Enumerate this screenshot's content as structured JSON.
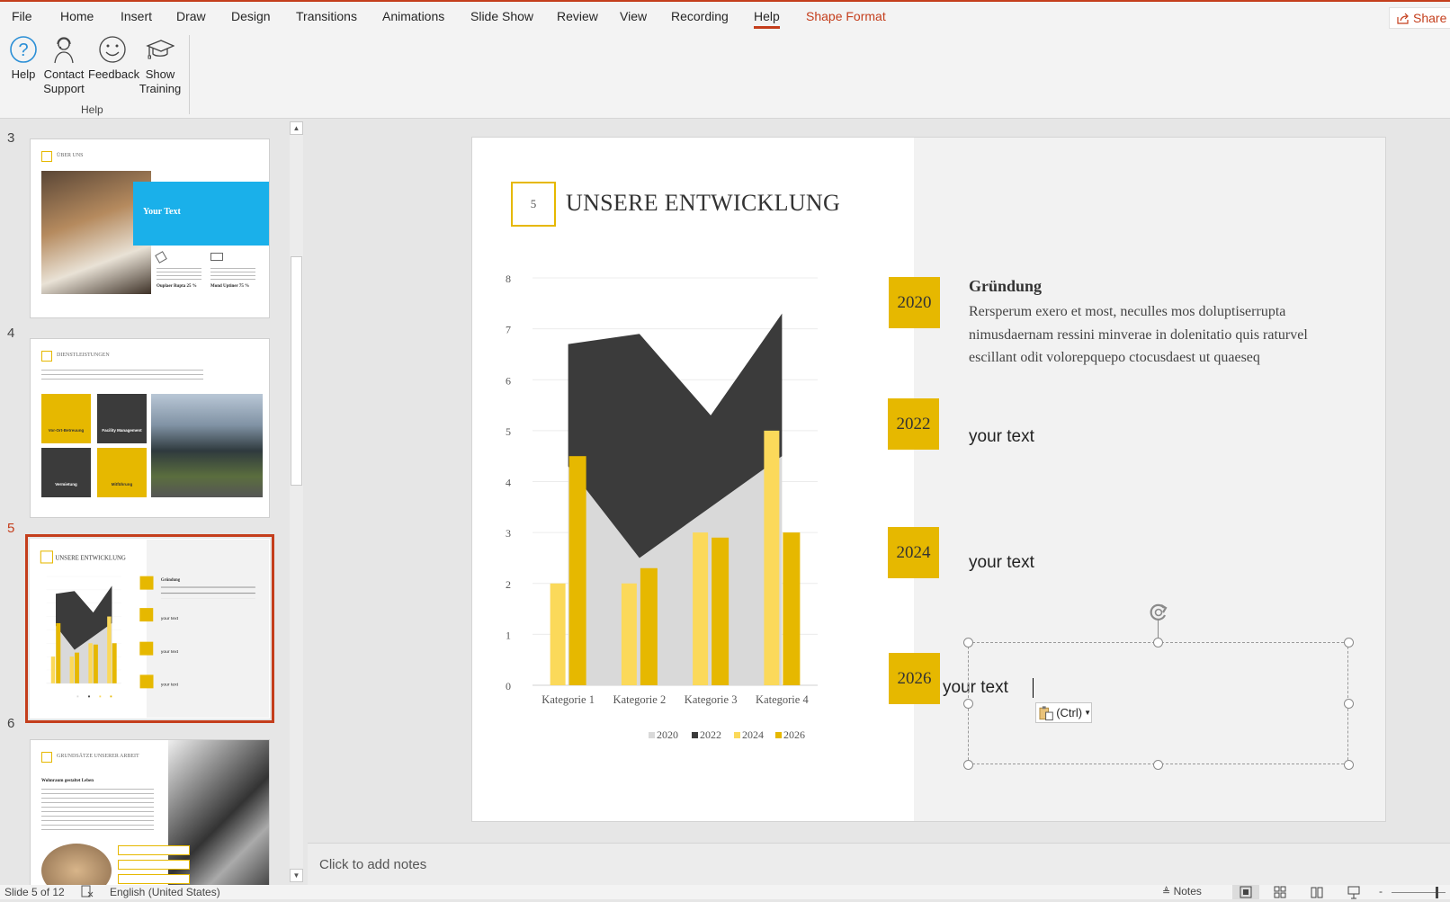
{
  "ribbon": {
    "tabs": [
      "File",
      "Home",
      "Insert",
      "Draw",
      "Design",
      "Transitions",
      "Animations",
      "Slide Show",
      "Review",
      "View",
      "Recording",
      "Help",
      "Shape Format"
    ],
    "active_tab": "Help",
    "share_label": "Share",
    "buttons": [
      {
        "label1": "Help",
        "label2": "",
        "icon": "help-circle-icon"
      },
      {
        "label1": "Contact",
        "label2": "Support",
        "icon": "headset-person-icon"
      },
      {
        "label1": "Feedback",
        "label2": "",
        "icon": "smiley-icon"
      },
      {
        "label1": "Show",
        "label2": "Training",
        "icon": "graduation-cap-icon"
      }
    ],
    "group_label": "Help"
  },
  "thumbnails": [
    {
      "number": "3",
      "title": "ÜBER UNS",
      "box": "Your Text",
      "stat1": "Ouplaer Rupta 25 %",
      "stat2": "Mond Uptiner 75 %"
    },
    {
      "number": "4",
      "title": "DIENSTLEISTUNGEN",
      "tiles": [
        "Vor-Ort-Betreuung",
        "Facility Management",
        "Vermietung",
        "Mitführung"
      ]
    },
    {
      "number": "5",
      "selected": true
    },
    {
      "number": "6",
      "title": "GRUNDSÄTZE UNSERER ARBEIT",
      "heading": "Wohnraum gestaltet Leben"
    }
  ],
  "slide": {
    "number": "5",
    "title": "UNSERE ENTWICKLUNG",
    "timeline": [
      {
        "year": "2020",
        "heading": "Gründung",
        "body": "Rersperum exero et most, neculles mos doluptiserrupta nimusdaernam ressini minverae in dolenitatio quis raturvel escillant odit volorepquepo ctocusdaest ut quaeseq"
      },
      {
        "year": "2022",
        "text": "your text"
      },
      {
        "year": "2024",
        "text": "your text"
      },
      {
        "year": "2026",
        "text": "your text"
      }
    ],
    "paste_options_label": "(Ctrl)"
  },
  "chart_data": {
    "type": "bar",
    "categories": [
      "Kategorie 1",
      "Kategorie 2",
      "Kategorie 3",
      "Kategorie 4"
    ],
    "series": [
      {
        "name": "2020",
        "type": "stacked-area",
        "values": [
          4.3,
          2.5,
          3.5,
          4.5
        ],
        "color": "#d9d9d9"
      },
      {
        "name": "2022",
        "type": "stacked-area",
        "values": [
          2.4,
          4.4,
          1.8,
          2.8
        ],
        "color": "#3b3b3b"
      },
      {
        "name": "2024",
        "type": "bar",
        "values": [
          2,
          2,
          3,
          5
        ],
        "color": "#fbd95a"
      },
      {
        "name": "2026",
        "type": "bar",
        "values": [
          4.5,
          2.3,
          2.9,
          3
        ],
        "color": "#e6b800"
      }
    ],
    "ylim": [
      0,
      8
    ],
    "yticks": [
      "0",
      "1",
      "2",
      "3",
      "4",
      "5",
      "6",
      "7",
      "8"
    ],
    "grid": true,
    "legend": "bottom"
  },
  "notes": {
    "placeholder": "Click to add notes"
  },
  "status": {
    "slide": "Slide 5 of 12",
    "language": "English (United States)",
    "notes": "Notes"
  },
  "colors": {
    "accent": "#c43e1c",
    "yellow": "#e6b800"
  }
}
